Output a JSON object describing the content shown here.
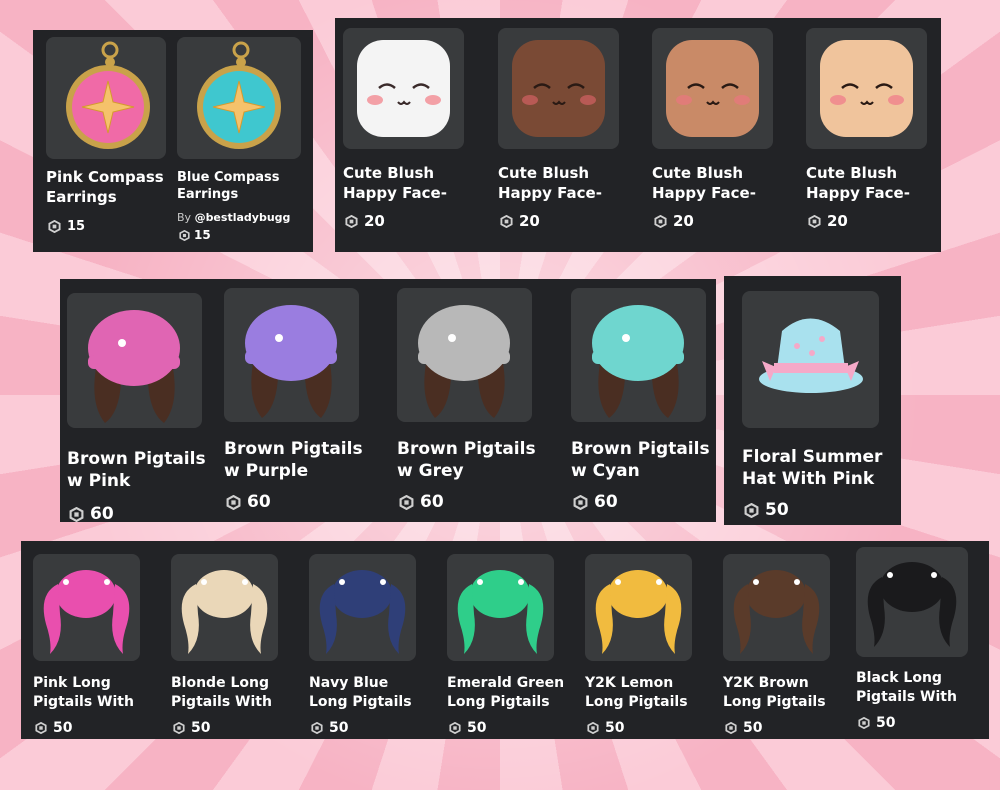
{
  "compass_panel": {
    "items": [
      {
        "name": "Pink Compass\nEarrings",
        "price": "15",
        "color": "#f06aa7"
      },
      {
        "name": "Blue Compass\nEarrings",
        "creator_prefix": "By ",
        "creator": "@bestladybugg",
        "price": "15",
        "color": "#3fc7cf"
      }
    ]
  },
  "face_panel": {
    "items": [
      {
        "name": "Cute Blush\nHappy Face-",
        "price": "20",
        "skin": "#f4f4f4"
      },
      {
        "name": "Cute Blush\nHappy Face-",
        "price": "20",
        "skin": "#7a4a35"
      },
      {
        "name": "Cute Blush\nHappy Face-",
        "price": "20",
        "skin": "#c98a67"
      },
      {
        "name": "Cute Blush\nHappy Face-",
        "price": "20",
        "skin": "#f0c49c"
      }
    ]
  },
  "pigtail_hat_panel": {
    "items": [
      {
        "name": "Brown Pigtails\nw Pink",
        "price": "60",
        "hat": "#e065b3"
      },
      {
        "name": "Brown Pigtails\nw Purple",
        "price": "60",
        "hat": "#9a7de0"
      },
      {
        "name": "Brown Pigtails\nw Grey",
        "price": "60",
        "hat": "#b8b8b8"
      },
      {
        "name": "Brown Pigtails\nw Cyan",
        "price": "60",
        "hat": "#6fd6cf"
      }
    ]
  },
  "hat_panel": {
    "items": [
      {
        "name": "Floral Summer\nHat With Pink",
        "price": "50",
        "color": "#a9e1ee"
      }
    ]
  },
  "long_pigtails_panel": {
    "items": [
      {
        "name": "Pink Long\nPigtails With",
        "price": "50",
        "hair": "#e94fae"
      },
      {
        "name": "Blonde Long\nPigtails With",
        "price": "50",
        "hair": "#ead7b8"
      },
      {
        "name": "Navy Blue\nLong Pigtails",
        "price": "50",
        "hair": "#2f3f78"
      },
      {
        "name": "Emerald Green\nLong Pigtails",
        "price": "50",
        "hair": "#2fce8a"
      },
      {
        "name": "Y2K Lemon\nLong Pigtails",
        "price": "50",
        "hair": "#f1bb3f"
      },
      {
        "name": "Y2K Brown\nLong Pigtails",
        "price": "50",
        "hair": "#5a3b2a"
      },
      {
        "name": "Black Long\nPigtails With",
        "price": "50",
        "hair": "#1a1a1c"
      }
    ]
  }
}
